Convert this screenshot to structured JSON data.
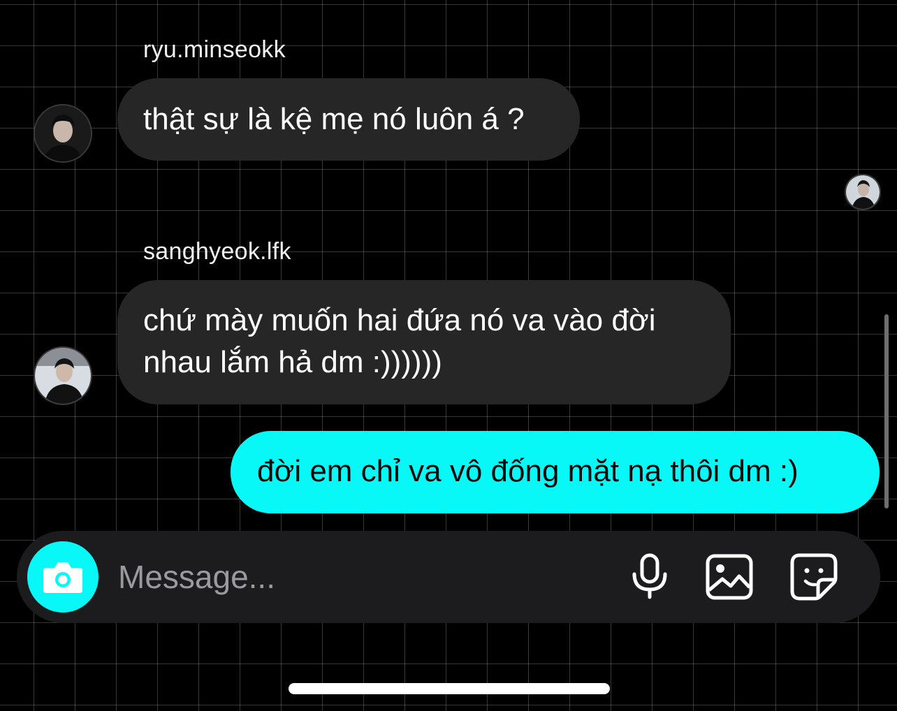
{
  "messages": [
    {
      "sender": "ryu.minseokk",
      "text": "thật sự là kệ mẹ nó luôn á ?",
      "direction": "incoming"
    },
    {
      "sender": "sanghyeok.lfk",
      "text": "chứ mày muốn hai đứa nó va vào đời nhau lắm hả dm :))))))",
      "direction": "incoming"
    },
    {
      "sender": "",
      "text": "đời em chỉ va vô đống mặt nạ thôi dm :)",
      "direction": "outgoing"
    }
  ],
  "composer": {
    "placeholder": "Message...",
    "camera_icon": "camera-icon",
    "mic_icon": "microphone-icon",
    "gallery_icon": "image-icon",
    "sticker_icon": "sticker-icon"
  },
  "colors": {
    "background": "#000000",
    "incoming_bubble": "#262626",
    "outgoing_bubble": "#08f7f7",
    "composer": "#1c1c1e"
  }
}
